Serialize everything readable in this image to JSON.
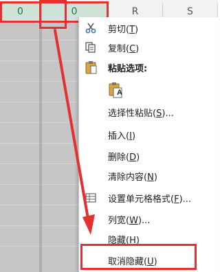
{
  "spreadsheet": {
    "columns": [
      {
        "label": "0",
        "state": "selected"
      },
      {
        "label": "0",
        "state": "selected"
      },
      {
        "label": "R",
        "state": "plain"
      },
      {
        "label": "S",
        "state": "plain"
      }
    ]
  },
  "context_menu": {
    "items": [
      {
        "icon": "scissors-icon",
        "label": "剪切",
        "key": "T",
        "suffix": ""
      },
      {
        "icon": "copy-icon",
        "label": "复制",
        "key": "C",
        "suffix": ""
      },
      {
        "icon": "clipboard-icon",
        "label": "粘贴选项:",
        "key": "",
        "suffix": ""
      },
      {
        "icon": "paste-values-icon",
        "label": "",
        "key": "",
        "suffix": ""
      },
      {
        "icon": "",
        "label": "选择性粘贴",
        "key": "S",
        "suffix": "..."
      },
      {
        "icon": "",
        "label": "插入",
        "key": "I",
        "suffix": ""
      },
      {
        "icon": "",
        "label": "删除",
        "key": "D",
        "suffix": ""
      },
      {
        "icon": "",
        "label": "清除内容",
        "key": "N",
        "suffix": ""
      },
      {
        "icon": "format-cells-icon",
        "label": "设置单元格格式",
        "key": "F",
        "suffix": "..."
      },
      {
        "icon": "",
        "label": "列宽",
        "key": "W",
        "suffix": "..."
      },
      {
        "icon": "",
        "label": "隐藏",
        "key": "H",
        "suffix": ""
      },
      {
        "icon": "",
        "label": "取消隐藏",
        "key": "U",
        "suffix": ""
      }
    ],
    "paste_option_letter": "A"
  },
  "annotation_color": "#e53030"
}
